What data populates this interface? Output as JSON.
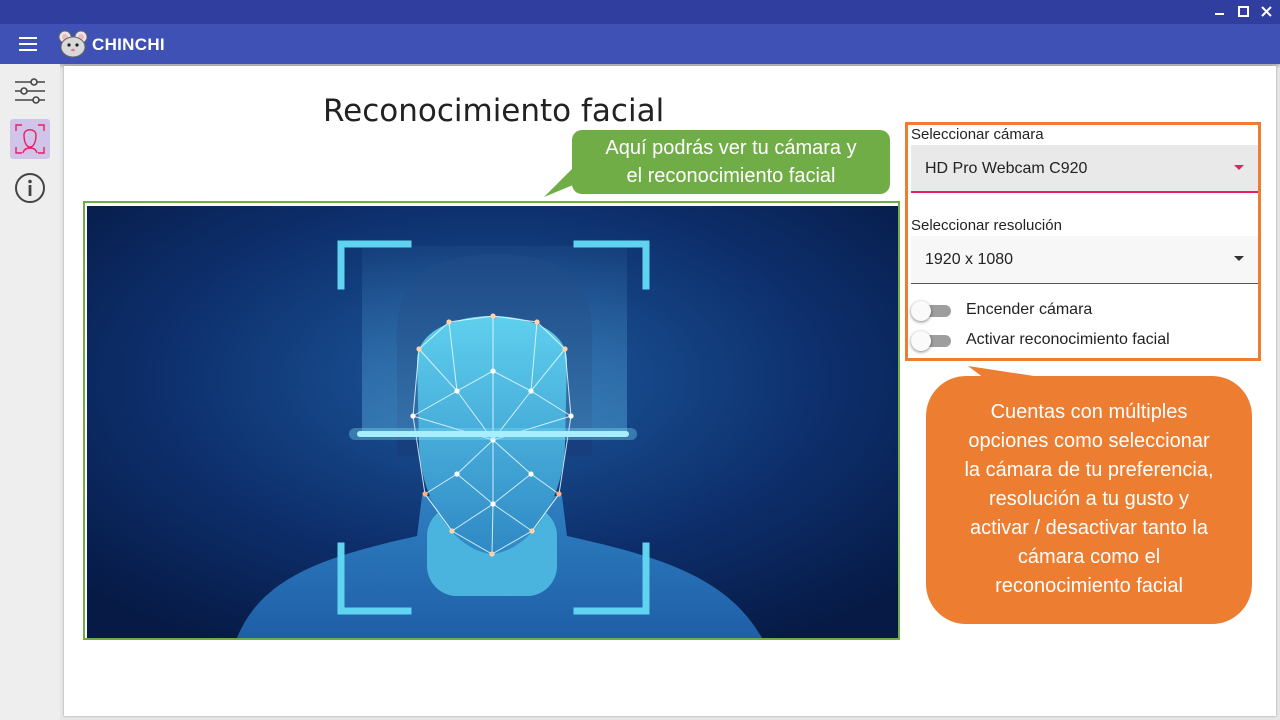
{
  "window": {
    "minimize_glyph": "▁",
    "maximize_glyph": "☐",
    "close_glyph": "✕"
  },
  "appbar": {
    "title": "CHINCHI"
  },
  "sidebar": {
    "items": [
      {
        "icon": "settings-sliders-icon"
      },
      {
        "icon": "face-recognition-icon",
        "active": true
      },
      {
        "icon": "info-icon"
      }
    ]
  },
  "page": {
    "title": "Reconocimiento facial"
  },
  "camera_controls": {
    "camera_label": "Seleccionar cámara",
    "camera_value": "HD Pro Webcam C920",
    "resolution_label": "Seleccionar resolución",
    "resolution_value": "1920 x 1080",
    "toggle_camera_label": "Encender cámara",
    "toggle_camera_on": false,
    "toggle_recognition_label": "Activar reconocimiento facial",
    "toggle_recognition_on": false
  },
  "annotations": {
    "camera_hint_line1": "Aquí podrás ver tu cámara y",
    "camera_hint_line2": "el reconocimiento facial",
    "options_hint_lines": [
      "Cuentas con múltiples",
      "opciones como seleccionar",
      "la cámara de tu preferencia,",
      "resolución a tu gusto y",
      "activar / desactivar tanto la",
      "cámara como el",
      "reconocimiento facial"
    ]
  },
  "colors": {
    "titlebar": "#303f9f",
    "appbar": "#3f51b5",
    "accent_pink": "#e91e63",
    "callout_green": "#70ad47",
    "callout_orange": "#ed7d31"
  }
}
